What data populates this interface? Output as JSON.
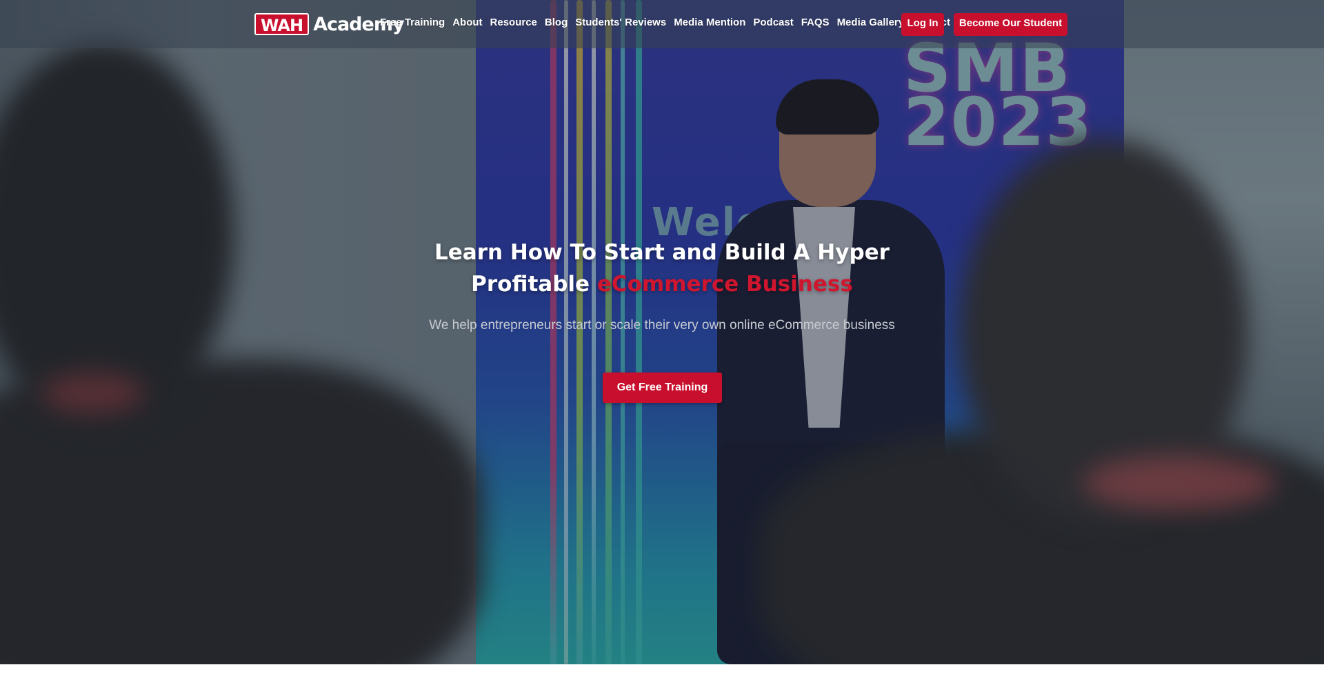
{
  "header": {
    "logo": {
      "badge": "WAH",
      "name": "Academy"
    },
    "nav": [
      {
        "label": "Free Training"
      },
      {
        "label": "About"
      },
      {
        "label": "Resource"
      },
      {
        "label": "Blog"
      },
      {
        "label": "Students' Reviews"
      },
      {
        "label": "Media Mention"
      },
      {
        "label": "Podcast"
      },
      {
        "label": "FAQS"
      },
      {
        "label": "Media Gallery"
      },
      {
        "label": "Contact"
      }
    ],
    "login_label": "Log In",
    "become_label": "Become Our Student"
  },
  "hero": {
    "title_line1": "Learn How To Start and Build A Hyper",
    "title_line2_plain": "Profitable",
    "title_line2_accent": "eCommerce Business",
    "subtitle": "We help entrepreneurs start or scale their very own online eCommerce business",
    "cta_label": "Get Free Training",
    "background": {
      "stage_sign": "SMB\n2023",
      "stage_welcome": "Welcome"
    }
  },
  "colors": {
    "brand_red": "#c8102e",
    "accent_red": "#d0152e",
    "text_white": "#ffffff",
    "subtitle_gray": "#c7cbd1"
  }
}
